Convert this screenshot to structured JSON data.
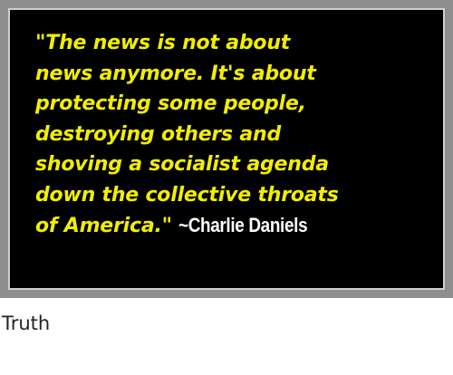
{
  "meme": {
    "quote_lines": [
      "\"The news is not about",
      "news anymore. It's about",
      "protecting some people,",
      "destroying others and",
      "shoving a socialist agenda",
      "down the collective throats"
    ],
    "last_line": "of America.\" ",
    "attribution": "~Charlie Daniels",
    "colors": {
      "text": "#f2ee00",
      "attribution": "#ffffff",
      "panel": "#000000",
      "frame": "#8e8e8e"
    }
  },
  "caption": {
    "text": "Truth"
  }
}
